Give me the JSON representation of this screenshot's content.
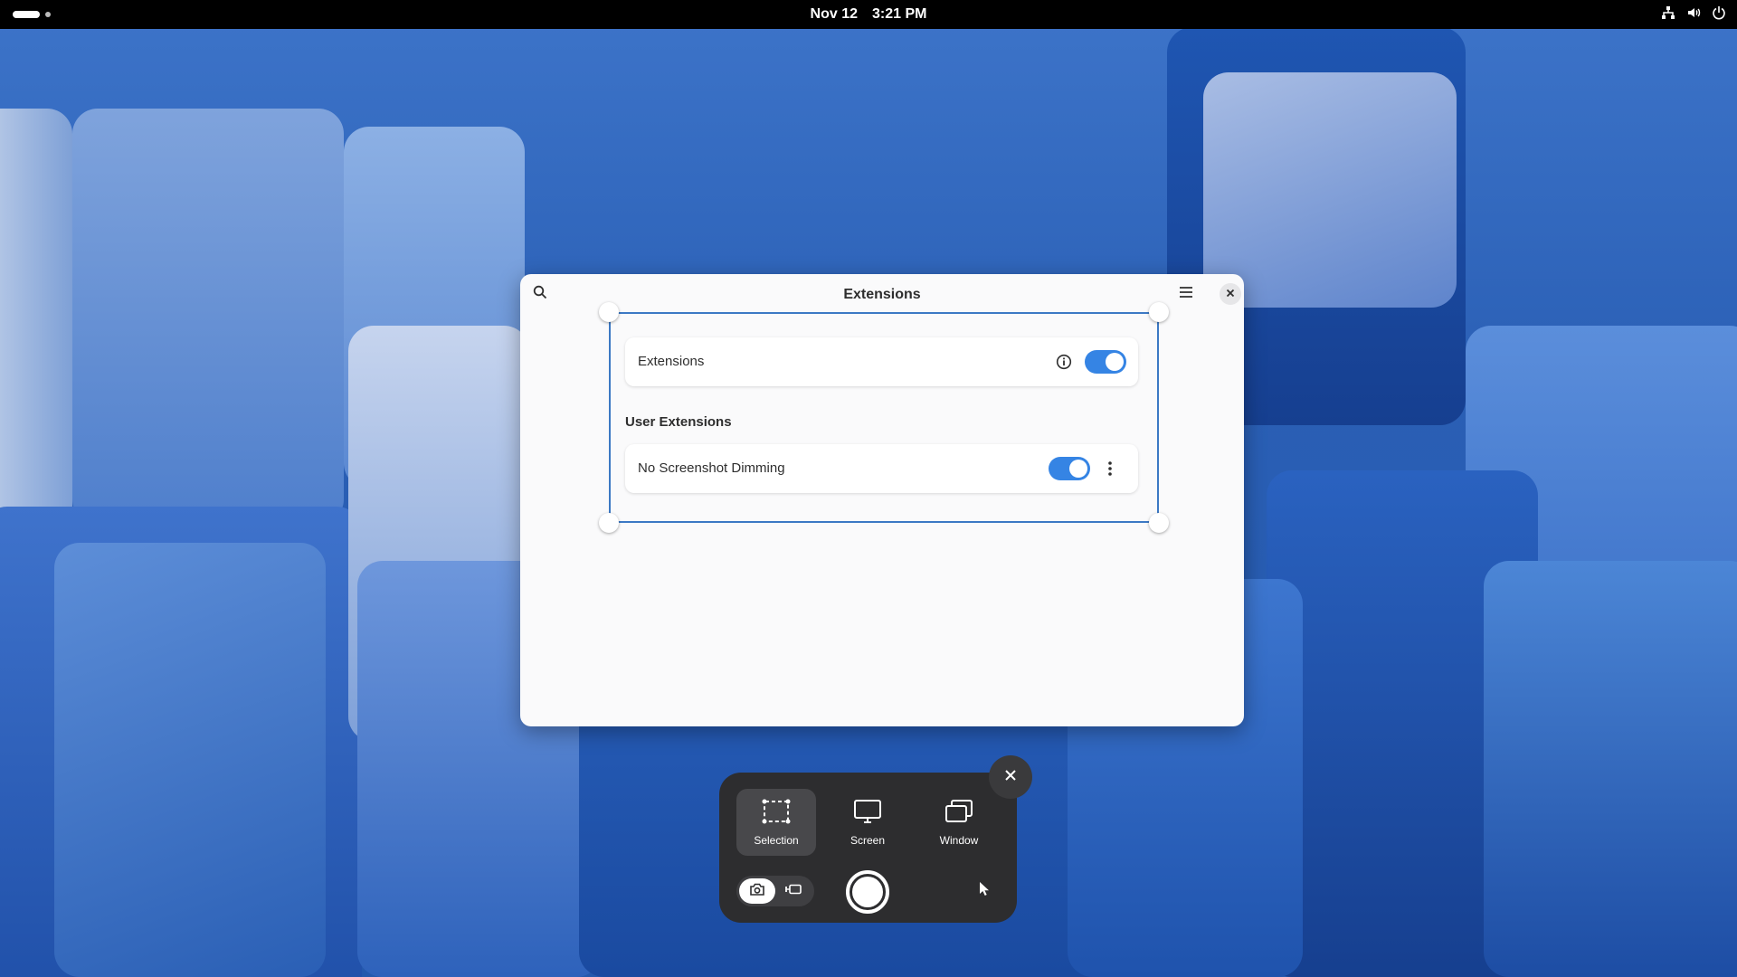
{
  "topbar": {
    "date": "Nov 12",
    "time": "3:21 PM",
    "icons": [
      "activities-indicator",
      "network-icon",
      "volume-icon",
      "power-icon"
    ]
  },
  "dialog": {
    "title": "Extensions",
    "icons": [
      "search-icon",
      "menu-icon",
      "close-icon"
    ],
    "extensions_row": {
      "label": "Extensions",
      "toggle_on": true,
      "info_icon": "info-icon"
    },
    "section_title": "User Extensions",
    "user_extensions": [
      {
        "label": "No Screenshot Dimming",
        "toggle_on": true,
        "menu_icon": "more-vertical-icon"
      }
    ]
  },
  "screenshot_ui": {
    "modes": [
      {
        "label": "Selection",
        "icon": "selection-icon",
        "active": true
      },
      {
        "label": "Screen",
        "icon": "screen-icon",
        "active": false
      },
      {
        "label": "Window",
        "icon": "window-icon",
        "active": false
      }
    ],
    "type_options": [
      {
        "icon": "camera-icon",
        "active": true
      },
      {
        "icon": "screencast-icon",
        "active": false
      }
    ],
    "capture_icon": "capture-icon",
    "pointer_icon": "pointer-icon",
    "close_icon": "close-icon"
  },
  "colors": {
    "accent": "#3584e4",
    "selection_border": "#3c79c4",
    "panel_bg": "#2d2d2f",
    "topbar_bg": "#000000"
  }
}
